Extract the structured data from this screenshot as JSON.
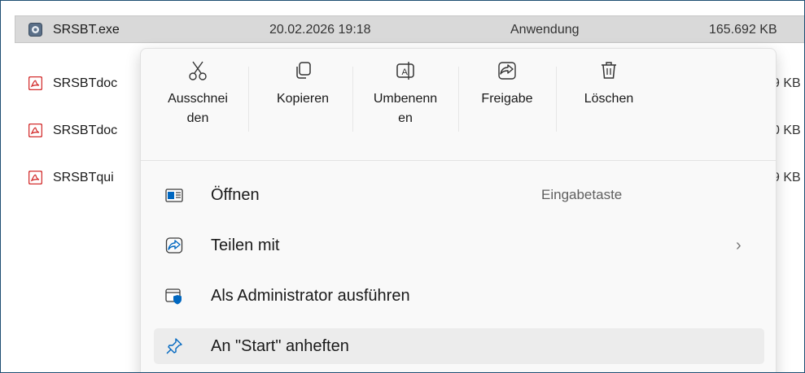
{
  "files": [
    {
      "name": "SRSBT.exe",
      "date": "20.02.2026 19:18",
      "type": "Anwendung",
      "size": "165.692 KB",
      "icon": "app-icon",
      "selected": true
    },
    {
      "name": "SRSBTdoc",
      "size_tail": "9 KB",
      "icon": "pdf-icon"
    },
    {
      "name": "SRSBTdoc",
      "size_tail": "0 KB",
      "icon": "pdf-icon"
    },
    {
      "name": "SRSBTqui",
      "size_tail": "9 KB",
      "icon": "pdf-icon"
    }
  ],
  "context_menu": {
    "quick_actions": [
      {
        "line1": "Ausschnei",
        "line2": "den",
        "icon": "scissors-icon"
      },
      {
        "line1": "Kopieren",
        "line2": "",
        "icon": "copy-icon"
      },
      {
        "line1": "Umbenenn",
        "line2": "en",
        "icon": "rename-icon"
      },
      {
        "line1": "Freigabe",
        "line2": "",
        "icon": "share-icon"
      },
      {
        "line1": "Löschen",
        "line2": "",
        "icon": "trash-icon"
      }
    ],
    "items": [
      {
        "label": "Öffnen",
        "shortcut": "Eingabetaste",
        "icon": "open-app-icon"
      },
      {
        "label": "Teilen mit",
        "chevron": "›",
        "icon": "share-icon"
      },
      {
        "label": "Als Administrator ausführen",
        "icon": "admin-shield-icon"
      },
      {
        "label": "An \"Start\" anheften",
        "icon": "pin-icon"
      }
    ]
  },
  "colors": {
    "accent": "#0067c0",
    "pdf_red": "#d32f2f",
    "border": "#1f4f73"
  }
}
